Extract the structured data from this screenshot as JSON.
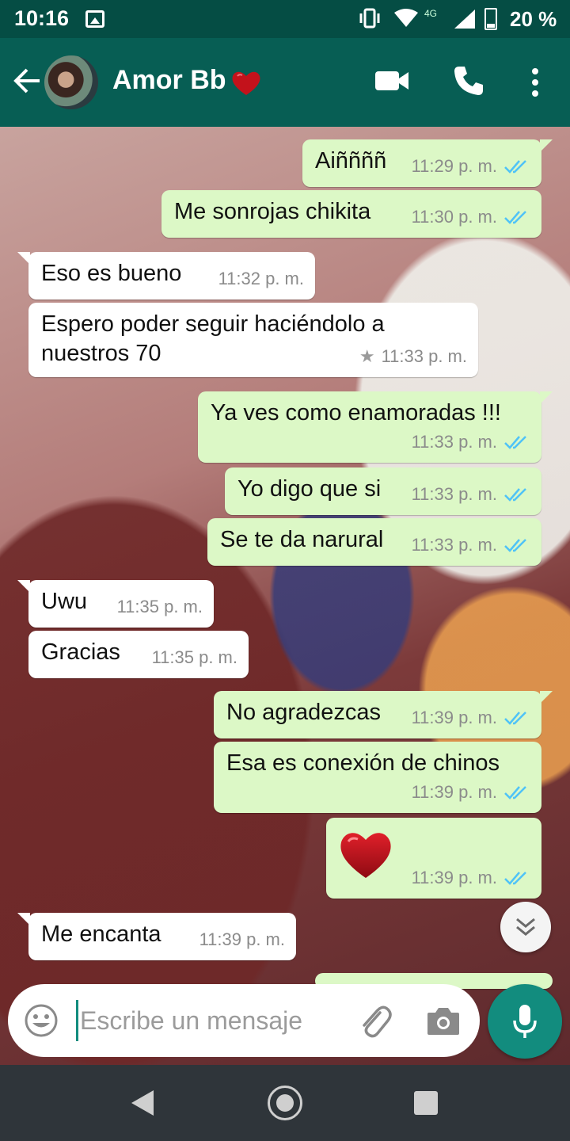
{
  "status_bar": {
    "time": "10:16",
    "network": "4G",
    "battery": "20 %",
    "icons": [
      "image-icon",
      "vibrate-icon",
      "wifi-icon",
      "signal-icon",
      "battery-icon"
    ]
  },
  "header": {
    "contact_name": "Amor Bb",
    "icons": [
      "back-arrow-icon",
      "avatar",
      "heart-emoji",
      "video-call-icon",
      "phone-icon",
      "more-vert-icon"
    ]
  },
  "messages": [
    {
      "dir": "out",
      "text": "Aiññññ",
      "time": "11:29 p. m.",
      "read": true
    },
    {
      "dir": "out",
      "text": "Me sonrojas chikita",
      "time": "11:30 p. m.",
      "read": true
    },
    {
      "dir": "in",
      "text": "Eso es bueno",
      "time": "11:32 p. m."
    },
    {
      "dir": "in",
      "text_line1": "Espero poder seguir haciéndolo a",
      "text_line2": "nuestros 70",
      "time": "11:33 p. m.",
      "starred": true
    },
    {
      "dir": "out",
      "text": "Ya ves como enamoradas !!!",
      "time": "11:33 p. m.",
      "read": true
    },
    {
      "dir": "out",
      "text": "Yo digo que si",
      "time": "11:33 p. m.",
      "read": true
    },
    {
      "dir": "out",
      "text": "Se te da narural",
      "time": "11:33 p. m.",
      "read": true
    },
    {
      "dir": "in",
      "text": "Uwu",
      "time": "11:35 p. m."
    },
    {
      "dir": "in",
      "text": "Gracias",
      "time": "11:35 p. m."
    },
    {
      "dir": "out",
      "text": "No agradezcas",
      "time": "11:39 p. m.",
      "read": true
    },
    {
      "dir": "out",
      "text": "Esa es conexión de chinos",
      "time": "11:39 p. m.",
      "read": true
    },
    {
      "dir": "out",
      "emoji": "heart",
      "time": "11:39 p. m.",
      "read": true
    },
    {
      "dir": "in",
      "text": "Me encanta",
      "time": "11:39 p. m."
    }
  ],
  "composer": {
    "placeholder": "Escribe un mensaje",
    "value": ""
  },
  "colors": {
    "header": "#075e54",
    "status_bar": "#054d44",
    "outgoing_bubble": "#dcf8c6",
    "incoming_bubble": "#ffffff",
    "read_ticks": "#4fc3f7",
    "mic_button": "#128c7e"
  }
}
